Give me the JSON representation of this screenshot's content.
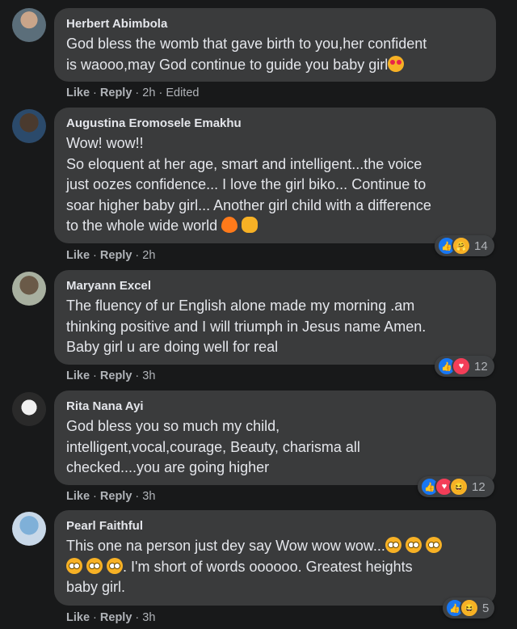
{
  "comments": [
    {
      "author": "Herbert Abimbola",
      "text": "God bless the womb that gave birth to you,her confident\nis waooo,may God continue to guide you baby girl",
      "trailing_emojis": [
        "heart-eyes"
      ],
      "actions": {
        "like": "Like",
        "reply": "Reply",
        "time": "2h",
        "edited": "Edited"
      },
      "reactions": null
    },
    {
      "author": "Augustina Eromosele Emakhu",
      "text": "Wow! wow!!\nSo eloquent at her age, smart and intelligent...the voice\njust oozes confidence... I love the girl biko... Continue to\nsoar higher baby girl... Another girl child with a difference\nto the whole wide world ",
      "trailing_emojis": [
        "fire",
        "hands"
      ],
      "actions": {
        "like": "Like",
        "reply": "Reply",
        "time": "2h"
      },
      "reactions": {
        "icons": [
          "like",
          "care"
        ],
        "count": "14"
      }
    },
    {
      "author": "Maryann Excel",
      "text": "The fluency of ur English alone made my morning .am\nthinking positive and I will triumph in Jesus name Amen.\nBaby girl u are doing well for real",
      "trailing_emojis": [],
      "actions": {
        "like": "Like",
        "reply": "Reply",
        "time": "3h"
      },
      "reactions": {
        "icons": [
          "like",
          "love"
        ],
        "count": "12"
      }
    },
    {
      "author": "Rita Nana Ayi",
      "text": "God bless you so much my child,\nintelligent,vocal,courage, Beauty, charisma all\nchecked....you are going higher",
      "trailing_emojis": [],
      "actions": {
        "like": "Like",
        "reply": "Reply",
        "time": "3h"
      },
      "reactions": {
        "icons": [
          "like",
          "love",
          "haha"
        ],
        "count": "12"
      }
    },
    {
      "author": "Pearl Faithful",
      "text_line1": "This one na person just dey say Wow wow wow...",
      "text_line2": ". I'm short of words oooooo. Greatest heights",
      "text_line3": "baby girl.",
      "actions": {
        "like": "Like",
        "reply": "Reply",
        "time": "3h"
      },
      "reactions": {
        "icons": [
          "like",
          "haha"
        ],
        "count": "5"
      }
    }
  ],
  "colors": {
    "background": "#18191a",
    "bubble": "#3a3b3c",
    "text": "#e4e6eb",
    "meta": "#b0b3b8",
    "like_blue": "#1877f2",
    "love_red": "#f33e58"
  }
}
